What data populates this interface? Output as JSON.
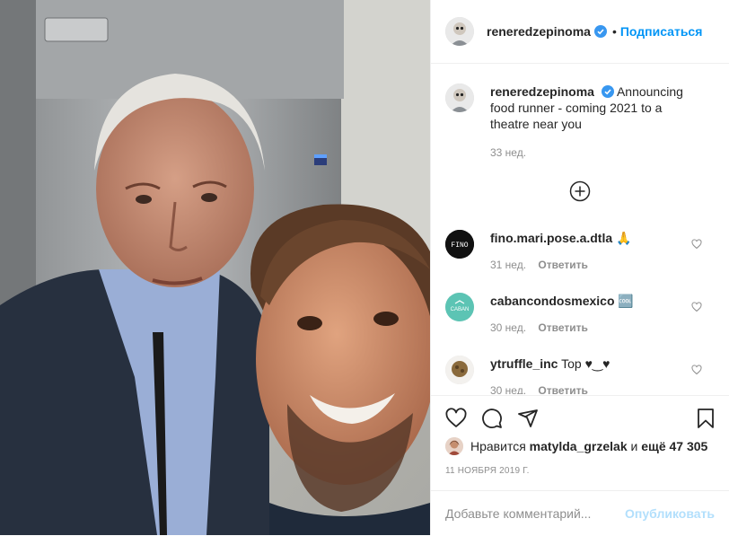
{
  "post": {
    "author": "reneredzepinoma",
    "follow_label": "Подписаться",
    "dot": "•",
    "caption": "Announcing food runner - coming 2021 to a theatre near you",
    "caption_time": "33 нед.",
    "load_more_icon": "plus-circle-icon"
  },
  "comments": [
    {
      "user": "fino.mari.pose.a.dtla",
      "text": "🙏",
      "time": "31 нед.",
      "reply": "Ответить",
      "avatar": "FINO"
    },
    {
      "user": "cabancondosmexico",
      "text": "🆒",
      "time": "30 нед.",
      "reply": "Ответить",
      "avatar": "CABAN"
    },
    {
      "user": "ytruffle_inc",
      "text": "Top ♥‿♥",
      "time": "30 нед.",
      "reply": "Ответить",
      "avatar": ""
    }
  ],
  "likes": {
    "prefix": "Нравится",
    "user": "matylda_grzelak",
    "middle": "и",
    "more": "ещё 47 305"
  },
  "date": "11 ноября 2019 г.",
  "composer": {
    "placeholder": "Добавьте комментарий...",
    "publish_label": "Опубликовать"
  },
  "colors": {
    "accent": "#0095f6",
    "publish_disabled": "#b2dffc",
    "muted": "#8e8e8e",
    "border": "#efefef"
  }
}
